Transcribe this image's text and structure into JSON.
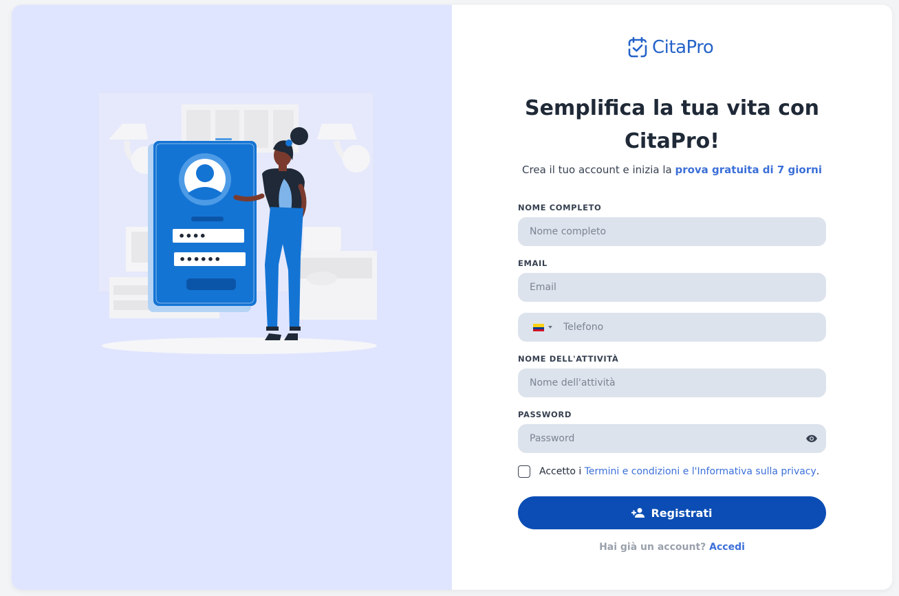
{
  "brand": {
    "name": "CitaPro",
    "color": "#2563c9",
    "logo_icon": "calendar-check-icon"
  },
  "illustration": {
    "alt": "woman-at-login-phone-illustration",
    "pin_mask": "••••",
    "password_mask": "••••••"
  },
  "heading": {
    "line1": "Semplifica la tua vita con",
    "line2": "CitaPro!"
  },
  "subtitle": {
    "prefix": "Crea il tuo account e inizia la ",
    "highlight": "prova gratuita di 7 giorni"
  },
  "form": {
    "full_name": {
      "label": "NOME COMPLETO",
      "placeholder": "Nome completo",
      "value": ""
    },
    "email": {
      "label": "EMAIL",
      "placeholder": "Email",
      "value": ""
    },
    "phone": {
      "placeholder": "Telefono",
      "value": "",
      "country_flag": "colombia-flag-icon"
    },
    "business": {
      "label": "NOME DELL'ATTIVITÀ",
      "placeholder": "Nome dell'attività",
      "value": ""
    },
    "password": {
      "label": "PASSWORD",
      "placeholder": "Password",
      "value": "",
      "toggle_icon": "eye-icon"
    },
    "terms": {
      "prefix": "Accetto i ",
      "link": "Termini e condizioni e l'Informativa sulla privacy",
      "suffix": ".",
      "checked": false
    },
    "submit": {
      "label": "Registrati",
      "icon": "person-add-icon"
    }
  },
  "footer": {
    "question": "Hai già un account? ",
    "link": "Accedi"
  },
  "colors": {
    "accent": "#0b4db4",
    "link": "#3b6fd8",
    "left_bg": "#e0e5ff",
    "input_bg": "#dde3ec"
  }
}
